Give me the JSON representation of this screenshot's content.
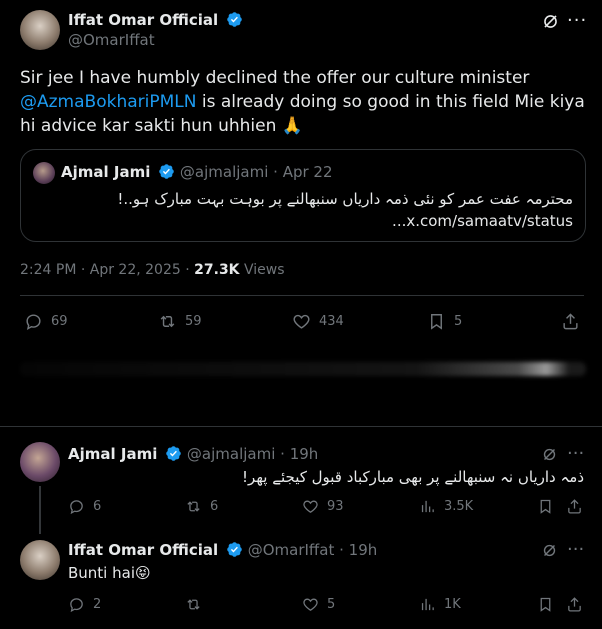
{
  "main_tweet": {
    "author_name": "Iffat Omar Official",
    "author_handle": "@OmarIffat",
    "text_part1": "Sir jee I have humbly declined the offer our culture minister",
    "mention": "@AzmaBokhariPMLN",
    "text_part2": " is already doing so good in this field Mie kiya hi advice kar sakti hun uhhien 🙏",
    "quote": {
      "author_name": "Ajmal Jami",
      "author_handle": "@ajmaljami",
      "date": "· Apr 22",
      "text": "محترمہ عفت عمر کو نئی ذمہ داریاں سنبھالنے پر بوہت بہت مبارک ہو..!",
      "link": "...x.com/samaatv/status"
    },
    "timestamp": "2:24 PM · Apr 22, 2025 ·",
    "views_count": "27.3K",
    "views_label": " Views",
    "replies": "69",
    "reposts": "59",
    "likes": "434",
    "bookmarks": "5"
  },
  "replies": [
    {
      "author_name": "Ajmal Jami",
      "author_handle": "@ajmaljami",
      "time": "· 19h",
      "text": "ذمہ داریاں نہ سنبھالنے پر بھی مبارکباد قبول کیجئے پھر!",
      "replies": "6",
      "reposts": "6",
      "likes": "93",
      "views": "3.5K"
    },
    {
      "author_name": "Iffat Omar Official",
      "author_handle": "@OmarIffat",
      "time": "· 19h",
      "text": "Bunti hai😝",
      "replies": "2",
      "reposts": "",
      "likes": "5",
      "views": "1K"
    }
  ],
  "colors": {
    "background": "#000000",
    "text": "#e7e9ea",
    "muted": "#71767b",
    "accent": "#1d9bf0",
    "border": "#2f3336"
  }
}
